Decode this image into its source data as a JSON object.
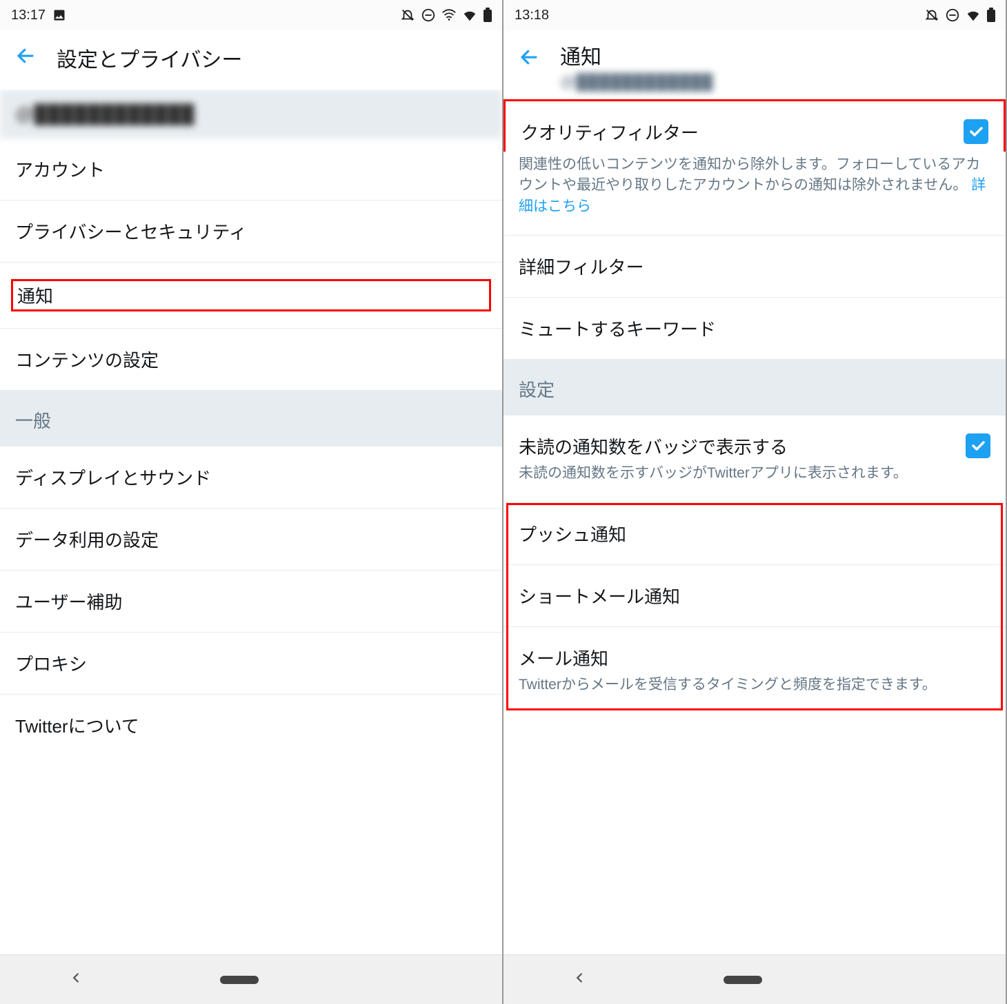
{
  "colors": {
    "accent": "#1da1f2",
    "highlight": "#ff0000",
    "muted": "#657786",
    "text": "#14171a",
    "section_bg": "#e6ecf0"
  },
  "left": {
    "status": {
      "time": "13:17"
    },
    "title": "設定とプライバシー",
    "account_handle": "@████████████",
    "rows": {
      "account": "アカウント",
      "privacy": "プライバシーとセキュリティ",
      "notifications": "通知",
      "content": "コンテンツの設定"
    },
    "section_general": "一般",
    "general_rows": {
      "display_sound": "ディスプレイとサウンド",
      "data_usage": "データ利用の設定",
      "accessibility": "ユーザー補助",
      "proxy": "プロキシ",
      "about_twitter": "Twitterについて"
    }
  },
  "right": {
    "status": {
      "time": "13:18"
    },
    "title": "通知",
    "account_handle": "@████████████",
    "quality_filter": {
      "title": "クオリティフィルター",
      "desc_text": "関連性の低いコンテンツを通知から除外します。フォローしているアカウントや最近やり取りしたアカウントからの通知は除外されません。",
      "link_text": "詳細はこちら",
      "checked": true
    },
    "advanced_filters": "詳細フィルター",
    "muted_keywords": "ミュートするキーワード",
    "section_settings": "設定",
    "unread_badge": {
      "title": "未読の通知数をバッジで表示する",
      "desc": "未読の通知数を示すバッジがTwitterアプリに表示されます。",
      "checked": true
    },
    "push": "プッシュ通知",
    "sms": "ショートメール通知",
    "email": {
      "title": "メール通知",
      "desc": "Twitterからメールを受信するタイミングと頻度を指定できます。"
    }
  }
}
